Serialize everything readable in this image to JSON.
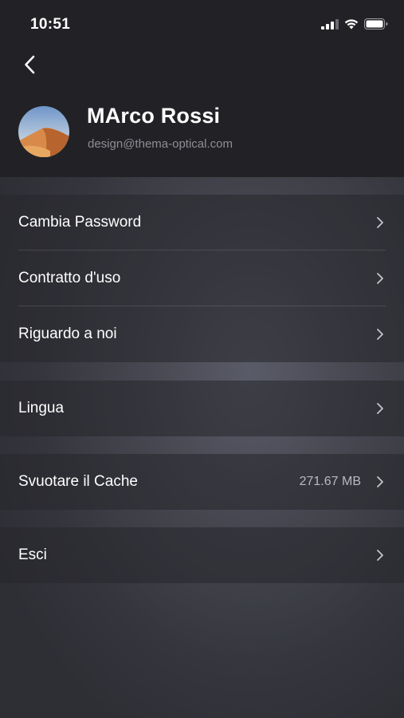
{
  "status_bar": {
    "time": "10:51",
    "icons": [
      "cellular-signal-icon",
      "wifi-icon",
      "battery-icon"
    ]
  },
  "nav": {
    "back_icon": "chevron-left-icon"
  },
  "profile": {
    "name": "MArco Rossi",
    "email": "design@thema-optical.com"
  },
  "menu": {
    "change_password": "Cambia Password",
    "terms": "Contratto d'uso",
    "about": "Riguardo a noi",
    "language": "Lingua",
    "clear_cache": "Svuotare il Cache",
    "cache_size": "271.67 MB",
    "logout": "Esci"
  },
  "colors": {
    "header_bg": "#222226",
    "secondary_text": "#8d8e94"
  }
}
